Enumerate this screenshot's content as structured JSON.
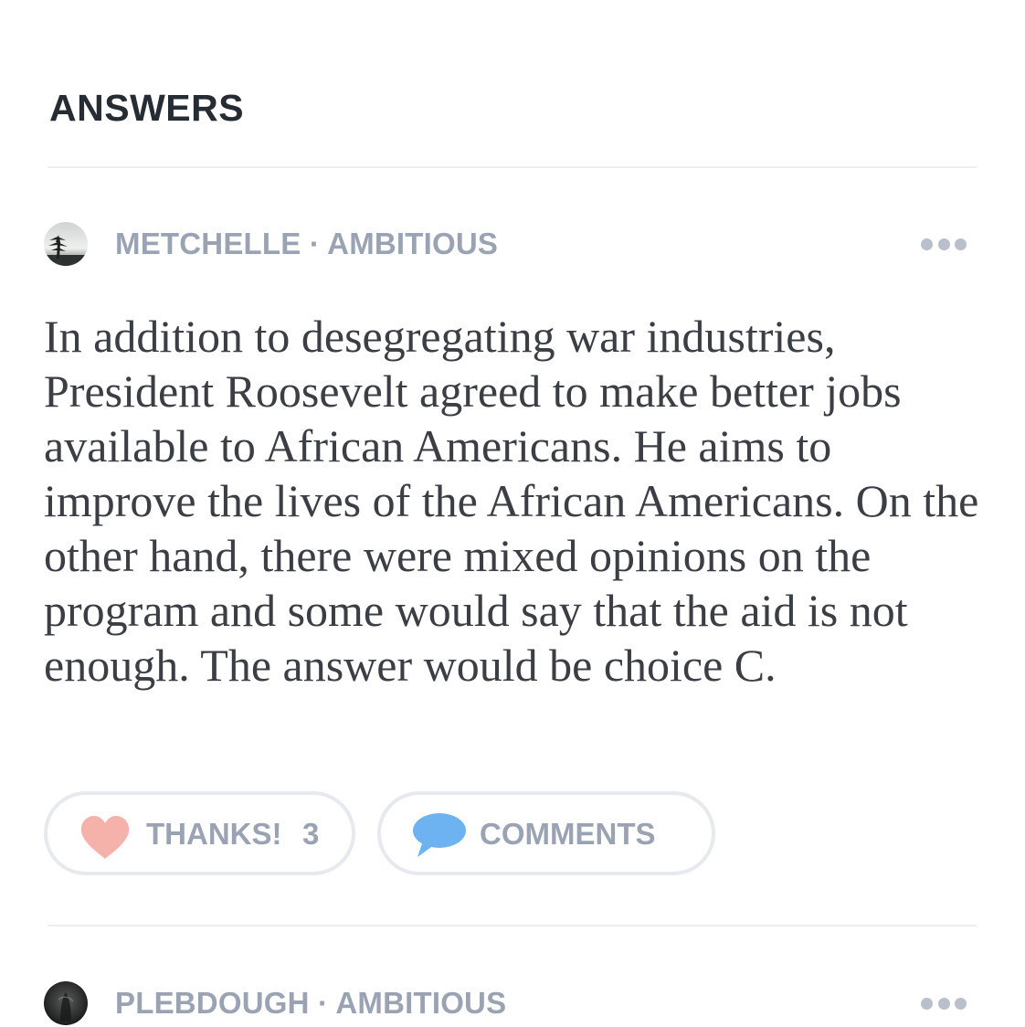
{
  "section": {
    "title": "ANSWERS"
  },
  "answers": [
    {
      "author": "METCHELLE · AMBITIOUS",
      "text": "In addition to desegregating war industries, President Roosevelt agreed to make better jobs available to African Americans. He aims to improve the lives of the African Americans. On the other hand, there were mixed opinions on the program and some would say that the aid is not enough. The answer would be choice C.",
      "thanks_label": "THANKS!",
      "thanks_count": "3",
      "comments_label": "COMMENTS"
    },
    {
      "author": "PLEBDOUGH · AMBITIOUS"
    }
  ],
  "icons": {
    "more": "more-horizontal-icon",
    "thanks": "heart-icon",
    "comments": "speech-bubble-icon"
  },
  "colors": {
    "heading": "#262c34",
    "meta": "#9aa3b3",
    "body_text": "#3b3e44",
    "heart": "#f5b2ab",
    "comment_bubble": "#6db3f2",
    "pill_border": "#e6e9ee",
    "divider": "#eceef1"
  }
}
